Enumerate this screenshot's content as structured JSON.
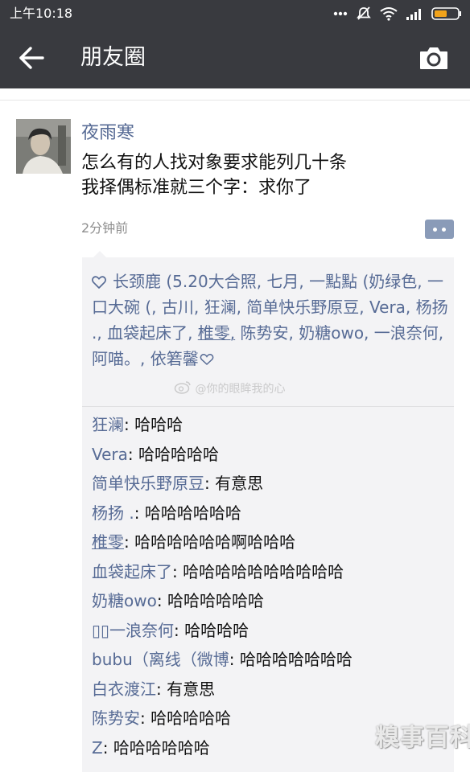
{
  "status_bar": {
    "time": "上午10:18",
    "dots": "..."
  },
  "header": {
    "title": "朋友圈"
  },
  "post": {
    "author": "夜雨寒",
    "lines": [
      "怎么有的人找对象要求能列几十条",
      "我择偶标准就三个字：求你了"
    ],
    "time": "2分钟前"
  },
  "likes": {
    "part1": "长颈鹿 (5.20大合照, 七月, 一點點 (奶绿色, 一口大碗 (, 古川, 狂澜, 简单快乐野原豆, Vera, 杨扬 ., 血袋起床了, ",
    "underlined": "椎零,",
    "part2": " 陈势安, 奶糖owo,       一浪奈何, 阿喵。, 依箬馨"
  },
  "comments": [
    {
      "name": "狂澜",
      "text": "哈哈哈",
      "underline": false
    },
    {
      "name": "Vera",
      "text": "哈哈哈哈哈",
      "underline": false
    },
    {
      "name": "简单快乐野原豆",
      "text": "有意思",
      "underline": false
    },
    {
      "name": "杨扬 .",
      "text": "哈哈哈哈哈哈",
      "underline": false
    },
    {
      "name": "椎零",
      "text": "哈哈哈哈哈哈啊哈哈哈",
      "underline": true
    },
    {
      "name": "血袋起床了",
      "text": "哈哈哈哈哈哈哈哈哈哈",
      "underline": false
    },
    {
      "name": "奶糖owo",
      "text": "哈哈哈哈哈哈",
      "underline": false
    },
    {
      "name": "▯▯一浪奈何",
      "text": "哈哈哈哈",
      "underline": false
    },
    {
      "name": "bubu（离线（微博",
      "text": "哈哈哈哈哈哈哈",
      "underline": false
    },
    {
      "name": "白衣渡江",
      "text": "有意思",
      "underline": false
    },
    {
      "name": "陈势安",
      "text": "哈哈哈哈哈",
      "underline": false
    },
    {
      "name": "Z",
      "text": "哈哈哈哈哈哈",
      "underline": false
    }
  ],
  "watermarks": {
    "weibo": "@你的眼眸我的心",
    "corner": "糗事百科"
  },
  "colors": {
    "header_bg": "#393a3f",
    "link": "#576b95",
    "text": "#111111",
    "meta": "#8e8e8e",
    "interaction_bg": "#f3f3f5"
  },
  "icons": {
    "back": "back-arrow-icon",
    "camera": "camera-icon",
    "comment": "comment-dots-icon",
    "like": "heart-icon",
    "wifi": "wifi-icon",
    "signal": "signal-icon",
    "battery": "battery-icon",
    "mute": "mute-icon"
  }
}
